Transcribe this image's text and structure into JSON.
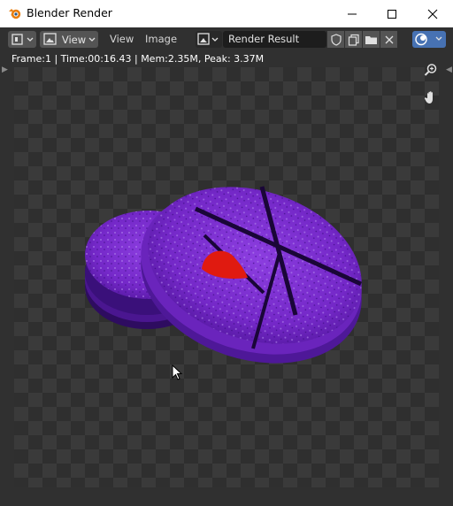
{
  "window": {
    "title": "Blender Render",
    "controls": [
      "minimize",
      "maximize",
      "close"
    ]
  },
  "header": {
    "editor_type_icon": "image-editor-icon",
    "view_mode_label": "View",
    "menus": [
      "View",
      "Image"
    ],
    "image_name": "Render Result",
    "icons": [
      "image-browse-icon",
      "shield-icon",
      "duplicate-icon",
      "folder-icon",
      "close-icon",
      "overlay-icon"
    ]
  },
  "status": {
    "info": "Frame:1 | Time:00:16.43 | Mem:2.35M, Peak: 3.37M"
  },
  "viewport": {
    "nav_icons": [
      "zoom-icon",
      "hand-pan-icon"
    ],
    "render_subject": "purple disc object",
    "colors": {
      "disc_purple": "#7a2fd0",
      "disc_dark": "#3a0f78",
      "marker_red": "#e01a10",
      "background_checker_light": "#3a3a3a",
      "background_checker_dark": "#2f2f2f"
    }
  },
  "colors": {
    "app_bg": "#303030",
    "titlebar_bg": "#ffffff",
    "blender_orange": "#e87d0d",
    "accent_blue": "#4772b3"
  }
}
